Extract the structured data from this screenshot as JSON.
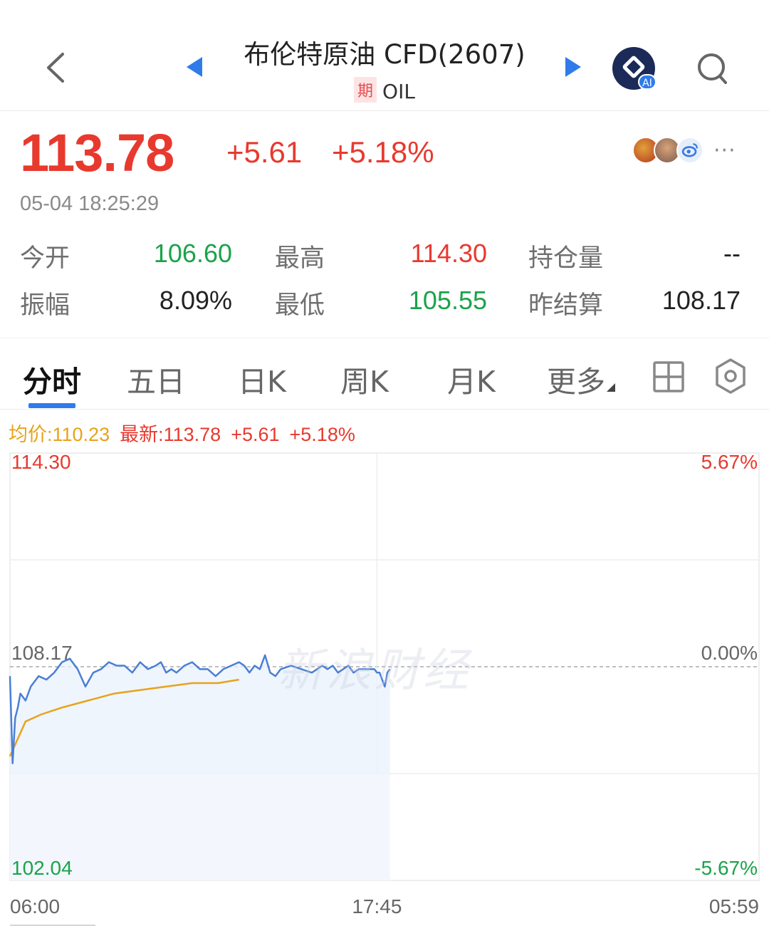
{
  "header": {
    "title": "布伦特原油 CFD(2607)",
    "badge": "期",
    "symbol": "OIL",
    "ai_tag": "AI"
  },
  "quote": {
    "price": "113.78",
    "change": "+5.61",
    "change_pct": "+5.18%",
    "time": "05-04 18:25:29"
  },
  "stats": [
    {
      "label": "今开",
      "value": "106.60",
      "color": "green"
    },
    {
      "label": "最高",
      "value": "114.30",
      "color": "red"
    },
    {
      "label": "持仓量",
      "value": "--",
      "color": "dark"
    },
    {
      "label": "振幅",
      "value": "8.09%",
      "color": "dark"
    },
    {
      "label": "最低",
      "value": "105.55",
      "color": "green"
    },
    {
      "label": "昨结算",
      "value": "108.17",
      "color": "dark"
    }
  ],
  "tabs": [
    {
      "label": "分时",
      "active": true
    },
    {
      "label": "五日",
      "active": false
    },
    {
      "label": "日K",
      "active": false
    },
    {
      "label": "周K",
      "active": false
    },
    {
      "label": "月K",
      "active": false
    },
    {
      "label": "更多",
      "active": false
    }
  ],
  "legend": {
    "avg": "均价:110.23",
    "latest": "最新:113.78",
    "change": "+5.61",
    "change_pct": "+5.18%"
  },
  "watermark": "新浪财经",
  "colors": {
    "up": "#e8392e",
    "down": "#1aa34a",
    "accent": "#2f7bea",
    "price_line": "#4a7fd4",
    "avg_line": "#e8a21a"
  },
  "chart_data": {
    "type": "line",
    "ylim": [
      102.04,
      114.3
    ],
    "reference": 108.17,
    "y_left_labels": [
      "114.30",
      "108.17",
      "102.04"
    ],
    "y_right_labels": [
      "5.67%",
      "0.00%",
      "-5.67%"
    ],
    "x_labels": [
      "06:00",
      "17:45",
      "05:59"
    ],
    "x_range_minutes": [
      0,
      1439
    ],
    "series": [
      {
        "role": "price",
        "x": [
          0,
          5,
          10,
          15,
          20,
          25,
          30,
          40,
          55,
          70,
          85,
          100,
          115,
          130,
          145,
          160,
          175,
          190,
          205,
          220,
          235,
          250,
          265,
          280,
          290,
          300,
          310,
          320,
          335,
          350,
          365,
          380,
          395,
          410,
          425,
          440,
          450,
          460,
          470,
          480,
          490,
          500,
          510,
          520,
          540,
          560,
          580,
          600,
          610,
          620,
          630,
          640,
          650,
          660,
          670,
          685,
          700,
          705,
          710,
          715,
          720,
          725,
          730
        ],
        "values": [
          107.9,
          105.4,
          106.7,
          107.0,
          107.4,
          107.3,
          107.2,
          107.6,
          107.9,
          107.8,
          108.0,
          108.3,
          108.4,
          108.1,
          107.6,
          108.0,
          108.1,
          108.3,
          108.2,
          108.2,
          108.0,
          108.3,
          108.1,
          108.2,
          108.3,
          108.0,
          108.1,
          108.0,
          108.2,
          108.3,
          108.1,
          108.1,
          107.9,
          108.1,
          108.2,
          108.3,
          108.2,
          108.0,
          108.2,
          108.1,
          108.5,
          108.0,
          107.9,
          108.1,
          108.2,
          108.1,
          108.0,
          108.2,
          108.1,
          108.2,
          108.0,
          108.1,
          108.2,
          108.0,
          108.1,
          108.1,
          108.1,
          108.0,
          108.0,
          107.8,
          107.6,
          108.0,
          108.1
        ]
      },
      {
        "role": "average",
        "x": [
          0,
          30,
          60,
          100,
          150,
          200,
          250,
          300,
          350,
          400,
          440
        ],
        "values": [
          105.6,
          106.6,
          106.8,
          107.0,
          107.2,
          107.4,
          107.5,
          107.6,
          107.7,
          107.7,
          107.8
        ]
      }
    ]
  }
}
